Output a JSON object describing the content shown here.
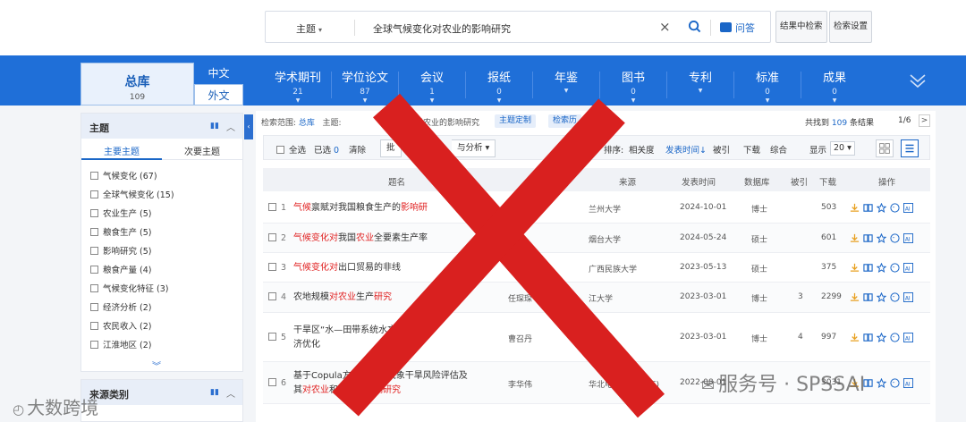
{
  "search": {
    "scope": "主题",
    "query": "全球气候变化对农业的影响研究",
    "qa_label": "问答",
    "in_results_label": "结果中检索",
    "settings_label": "检索设置"
  },
  "nav": {
    "all_label": "总库",
    "all_count": "109",
    "lang_cn": "中文",
    "lang_en": "外文",
    "categories": [
      {
        "label": "学术期刊",
        "count": "21"
      },
      {
        "label": "学位论文",
        "count": "87"
      },
      {
        "label": "会议",
        "count": "1"
      },
      {
        "label": "报纸",
        "count": "0"
      },
      {
        "label": "年鉴",
        "count": ""
      },
      {
        "label": "图书",
        "count": "0"
      },
      {
        "label": "专利",
        "count": ""
      },
      {
        "label": "标准",
        "count": "0"
      },
      {
        "label": "成果",
        "count": "0"
      }
    ]
  },
  "sidebar": {
    "title": "主题",
    "tab_primary": "主要主题",
    "tab_secondary": "次要主题",
    "items": [
      "气候变化 (67)",
      "全球气候变化 (15)",
      "农业生产 (5)",
      "粮食生产 (5)",
      "影响研究 (5)",
      "粮食产量 (4)",
      "气候变化特征 (3)",
      "经济分析 (2)",
      "农民收入 (2)",
      "江淮地区 (2)"
    ],
    "more": "︾",
    "source_title": "来源类别"
  },
  "results": {
    "crumb_label": "检索范围:",
    "crumb_scope": "总库",
    "crumb_topic": "主题:",
    "crumb_query_tail": "对农业的影响研究",
    "tag_custom": "主题定制",
    "tag_history": "检索历",
    "found_prefix": "共找到",
    "found_count": "109",
    "found_suffix": "条结果",
    "page": "1/6",
    "page_next": ">",
    "toolbar": {
      "select_all": "全选",
      "selected_prefix": "已选",
      "selected_count": "0",
      "clear": "清除",
      "batch": "批",
      "analysis": "与分析 ▾",
      "sort_label": "排序:",
      "sort_relevance": "相关度",
      "sort_date": "发表时间↓",
      "sort_cited": "被引",
      "sort_download": "下载",
      "sort_overall": "综合",
      "show_label": "显示",
      "show_count": "20 ▾"
    },
    "headers": {
      "title": "题名",
      "author": "者",
      "source": "来源",
      "date": "发表时间",
      "db": "数据库",
      "cited": "被引",
      "downloads": "下载",
      "ops": "操作"
    },
    "rows": [
      {
        "num": "1",
        "pre": "",
        "hl1": "气候",
        "mid": "禀赋对我国粮食生产的",
        "hl2": "影响研",
        "post": "",
        "l2pre": "",
        "l2hl": "",
        "l2post": "",
        "author": "",
        "source": "兰州大学",
        "date": "2024-10-01",
        "db": "博士",
        "cited": "",
        "downloads": "503"
      },
      {
        "num": "2",
        "pre": "",
        "hl1": "气候变化对",
        "mid": "我国",
        "hl2": "农业",
        "post": "全要素生产率",
        "l2pre": "",
        "l2hl": "",
        "l2post": "",
        "author": "",
        "source": "烟台大学",
        "date": "2024-05-24",
        "db": "硕士",
        "cited": "",
        "downloads": "601"
      },
      {
        "num": "3",
        "pre": "",
        "hl1": "气候变化对",
        "mid": "出口贸易的非线",
        "hl2": "",
        "post": "",
        "l2pre": "",
        "l2hl": "",
        "l2post": "",
        "author": "",
        "source": "广西民族大学",
        "date": "2023-05-13",
        "db": "硕士",
        "cited": "",
        "downloads": "375"
      },
      {
        "num": "4",
        "pre": "农地规模",
        "hl1": "对农业",
        "mid": "生产",
        "hl2": "研究",
        "post": "",
        "l2pre": "",
        "l2hl": "",
        "l2post": "",
        "author": "任琛琛",
        "source": "江大学",
        "date": "2023-03-01",
        "db": "博士",
        "cited": "3",
        "downloads": "2299"
      },
      {
        "num": "5",
        "pre": "干旱区“水—",
        "hl1": "",
        "mid": "",
        "hl2": "",
        "post": "田带系统水文经",
        "l2pre": "济优化",
        "l2hl": "",
        "l2post": "",
        "author": "曹召丹",
        "source": "",
        "date": "2023-03-01",
        "db": "博士",
        "cited": "4",
        "downloads": "997"
      },
      {
        "num": "6",
        "pre": "基于Copula方法的新疆气象干旱风险评估及",
        "hl1": "",
        "mid": "",
        "hl2": "",
        "post": "",
        "l2pre": "其",
        "l2hl": "对农业",
        "l2post": "和植被的",
        "l2hl2": "影响研究",
        "author": "李华伟",
        "source": "华北电力大学(北京)",
        "date": "2022-08-01",
        "db": "",
        "cited": "",
        "downloads": "3031"
      }
    ]
  },
  "watermarks": {
    "left": "大数跨境",
    "right": "服务号 · SPSSAI"
  },
  "colors": {
    "brand": "#1f6fd8",
    "highlight": "#e02020",
    "cross": "#d9201f"
  }
}
